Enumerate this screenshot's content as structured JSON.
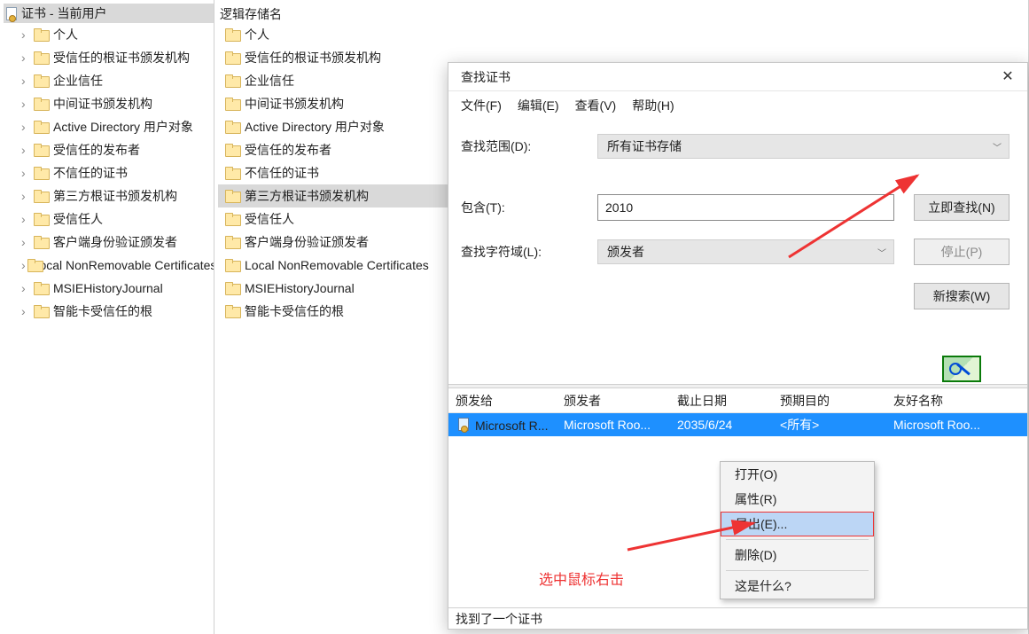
{
  "left_tree": {
    "root": "证书 - 当前用户",
    "items": [
      "个人",
      "受信任的根证书颁发机构",
      "企业信任",
      "中间证书颁发机构",
      "Active Directory 用户对象",
      "受信任的发布者",
      "不信任的证书",
      "第三方根证书颁发机构",
      "受信任人",
      "客户端身份验证颁发者",
      "Local NonRemovable Certificates",
      "MSIEHistoryJournal",
      "智能卡受信任的根"
    ]
  },
  "middle": {
    "header": "逻辑存储名",
    "items": [
      "个人",
      "受信任的根证书颁发机构",
      "企业信任",
      "中间证书颁发机构",
      "Active Directory 用户对象",
      "受信任的发布者",
      "不信任的证书",
      "第三方根证书颁发机构",
      "受信任人",
      "客户端身份验证颁发者",
      "Local NonRemovable Certificates",
      "MSIEHistoryJournal",
      "智能卡受信任的根"
    ],
    "selected_index": 7
  },
  "dialog": {
    "title": "查找证书",
    "menu": [
      "文件(F)",
      "编辑(E)",
      "查看(V)",
      "帮助(H)"
    ],
    "scope_label": "查找范围(D):",
    "scope_value": "所有证书存储",
    "contains_label": "包含(T):",
    "contains_value": "2010",
    "field_label": "查找字符域(L):",
    "field_value": "颁发者",
    "btn_find": "立即查找(N)",
    "btn_stop": "停止(P)",
    "btn_new": "新搜索(W)",
    "grid": {
      "cols": [
        "颁发给",
        "颁发者",
        "截止日期",
        "预期目的",
        "友好名称"
      ],
      "row": {
        "issued_to": "Microsoft R...",
        "issuer": "Microsoft Roo...",
        "expiry": "2035/6/24",
        "purpose": "<所有>",
        "friendly": "Microsoft Roo..."
      }
    },
    "status": "找到了一个证书"
  },
  "context_menu": {
    "items": [
      "打开(O)",
      "属性(R)",
      "导出(E)...",
      "删除(D)",
      "这是什么?"
    ],
    "selected_index": 2
  },
  "annotation": "选中鼠标右击"
}
